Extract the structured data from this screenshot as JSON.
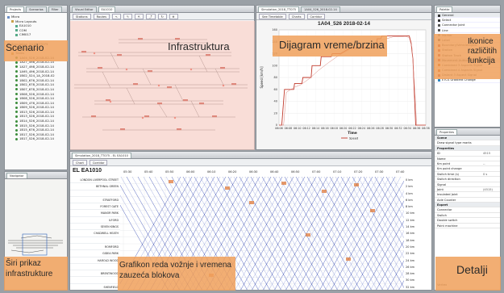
{
  "projects": {
    "tabs": [
      "Projects",
      "Scenarios",
      "Filter"
    ],
    "tree": [
      "Micro",
      "Micro Layouts",
      "EA1010",
      "COM",
      "CIM017"
    ],
    "sim_tree": [
      "Simulation_2018_TT075",
      "Micro Layouts",
      "Trains"
    ],
    "trains": [
      "1A04_526_2018-02-14",
      "1A27_498_2018-02-14",
      "1A27_498_2018-02-14",
      "1A95_496_2018-02-14",
      "1B02_524_1A_2018-02",
      "1B02_676_2018-02-14",
      "1B02_678_2018-02-14",
      "1B07_678_2018-02-14",
      "1B08_526_2018-02-14",
      "1B08_526_2018-02-14",
      "1B09_476_2018-02-14",
      "1B09_526_2018-02-14",
      "1B13_526_2018-02-14",
      "1B13_526_2018-02-14",
      "1B14_526_2018-02-14",
      "1B15_526_2018-02-14",
      "1B15_676_2018-02-14",
      "1B17_526_2018-02-14",
      "1B17_526_2018-02-14"
    ]
  },
  "navigator": {
    "tab": "Navigator"
  },
  "infra": {
    "tabs": [
      "Visual Editor",
      "EA1010"
    ],
    "toolbar": [
      "Stations",
      "Routes"
    ]
  },
  "diagram": {
    "tabs": [
      "Simulation_2018_TT075",
      "1A04_526_2018-02-14"
    ],
    "subtabs": [
      "See Timetable",
      "Charts",
      "Corridor"
    ],
    "title": "1A04_526 2018-02-14",
    "ylabel": "Speed [km/h]",
    "xlabel": "Time",
    "legend": "Speed"
  },
  "graph": {
    "tab": "Simulation_2018_TT075 - EL EA1010",
    "subtabs": [
      "Chart",
      "Corridor"
    ],
    "title": "EL EA1010",
    "times": [
      "05:30",
      "05:40",
      "05:50",
      "06:00",
      "06:10",
      "06:20",
      "06:30",
      "06:40",
      "06:50",
      "07:00",
      "07:10",
      "07:20",
      "07:30",
      "07:40"
    ],
    "stations": [
      "LONDON LIVERPOOL STREET",
      "BETHNAL GREEN",
      "",
      "STRATFORD",
      "FOREST GATE",
      "MANOR PARK",
      "ILFORD",
      "SEVEN KINGS",
      "CHADWELL HEATH",
      "",
      "ROMFORD",
      "GIDEA PARK",
      "HAROLD WOOD",
      "",
      "BRENTWOOD",
      "",
      "SHENFIELD"
    ],
    "km": [
      "0 km",
      "2 km",
      "4 km",
      "6 km",
      "8 km",
      "10 km",
      "12 km",
      "14 km",
      "16 km",
      "18 km",
      "20 km",
      "22 km",
      "24 km",
      "26 km",
      "28 km",
      "30 km",
      "32 km"
    ]
  },
  "palette": {
    "tab": "Palette",
    "items": [
      "General",
      "Select",
      "Connector Joint",
      "Line",
      "Marker",
      "Label",
      "Boundary/VehicleSignal",
      "Station",
      "Station Track",
      "Movement Authority Signals",
      "Combined 3 Aspects Signal",
      "Combined 4 Aspects Signal",
      "Distant 3 Aspect Signal",
      "ETCS Gradient Change"
    ]
  },
  "properties": {
    "tab": "Properties",
    "rows": [
      {
        "k": "Scene",
        "v": "",
        "sec": true
      },
      {
        "k": "Draw signal type marks",
        "v": ""
      },
      {
        "k": "Properties",
        "v": "",
        "sec": true
      },
      {
        "k": "ID",
        "v": "4515"
      },
      {
        "k": "Name",
        "v": ""
      },
      {
        "k": "Km point",
        "v": "--"
      },
      {
        "k": "Km point change",
        "v": ""
      },
      {
        "k": "Switch time (s)",
        "v": "0 s"
      },
      {
        "k": "Switch direction",
        "v": ""
      },
      {
        "k": "Signal",
        "v": ""
      },
      {
        "k": "Joint",
        "v": "(4515)"
      },
      {
        "k": "Insulated Joint",
        "v": ""
      },
      {
        "k": "Axle Counter",
        "v": ""
      },
      {
        "k": "Expert",
        "v": "",
        "sec": true
      },
      {
        "k": "Connector",
        "v": ""
      },
      {
        "k": "Switch",
        "v": ""
      },
      {
        "k": "Double switch",
        "v": ""
      },
      {
        "k": "Point machine",
        "v": ""
      }
    ],
    "vertex": "Vertex"
  },
  "labels": {
    "scenario": "Scenario",
    "infra": "Infrastruktura",
    "diagram": "Dijagram vreme/brzina",
    "icons": "Ikonice različitih funkcija",
    "overview": "Širi prikaz infrastrukture",
    "graph": "Grafikon reda vožnje i vremena zauzeća blokova",
    "details": "Detalji"
  },
  "chart_data": {
    "type": "line",
    "title": "1A04_526 2018-02-14",
    "xlabel": "Time",
    "ylabel": "Speed [km/h]",
    "x": [
      "06:06",
      "06:08",
      "06:10",
      "06:12",
      "06:14",
      "06:16",
      "06:18",
      "06:20",
      "06:22",
      "06:24",
      "06:26",
      "06:28",
      "06:30",
      "06:32",
      "06:34",
      "06:36",
      "06:38"
    ],
    "ylim": [
      0,
      160
    ],
    "series": [
      {
        "name": "Speed",
        "points": [
          [
            0,
            0
          ],
          [
            0.3,
            0
          ],
          [
            0.6,
            60
          ],
          [
            1.6,
            60
          ],
          [
            1.7,
            70
          ],
          [
            2.5,
            70
          ],
          [
            2.6,
            80
          ],
          [
            3.5,
            80
          ],
          [
            3.6,
            100
          ],
          [
            4.5,
            100
          ],
          [
            4.6,
            115
          ],
          [
            5.7,
            115
          ],
          [
            5.8,
            120
          ],
          [
            6.7,
            120
          ],
          [
            7.8,
            130
          ],
          [
            10.6,
            130
          ],
          [
            10.7,
            145
          ],
          [
            11.1,
            145
          ],
          [
            11.2,
            150
          ],
          [
            14.2,
            150
          ],
          [
            14.4,
            138
          ],
          [
            14.6,
            110
          ],
          [
            14.9,
            0
          ],
          [
            16,
            0
          ]
        ]
      },
      {
        "name": "",
        "points": [
          [
            0,
            0
          ],
          [
            0.5,
            0
          ],
          [
            0.8,
            55
          ],
          [
            1.3,
            60
          ],
          [
            1.6,
            63
          ],
          [
            2.4,
            68
          ],
          [
            3.3,
            78
          ],
          [
            4.3,
            92
          ],
          [
            5.4,
            105
          ],
          [
            6.6,
            118
          ],
          [
            7.8,
            128
          ],
          [
            9.0,
            129
          ],
          [
            10.5,
            131
          ],
          [
            11.2,
            143
          ],
          [
            12.4,
            148
          ],
          [
            13.8,
            149
          ],
          [
            14.2,
            147
          ],
          [
            14.5,
            130
          ],
          [
            14.8,
            60
          ],
          [
            15.0,
            0
          ],
          [
            16,
            0
          ]
        ]
      }
    ]
  }
}
